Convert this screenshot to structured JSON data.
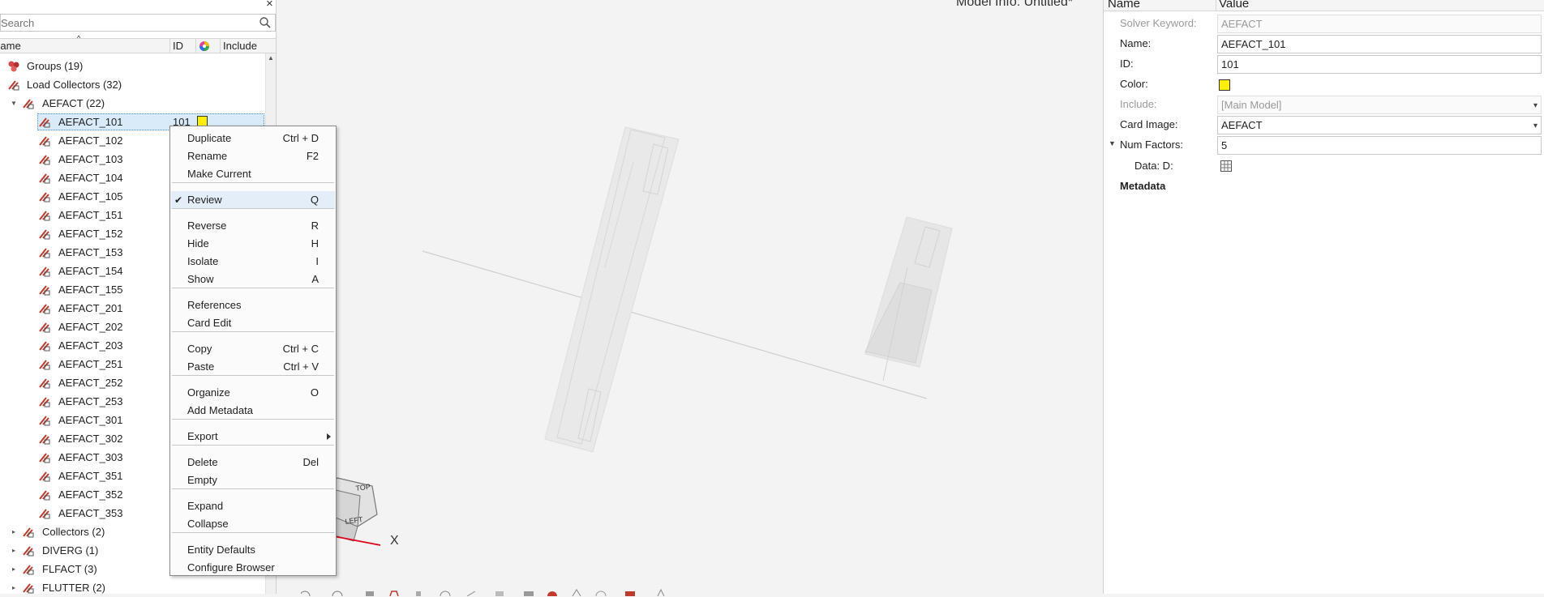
{
  "browser": {
    "search_placeholder": "Search",
    "columns": {
      "name": "Name",
      "id": "ID",
      "include": "Include"
    },
    "tree": [
      {
        "label": "Groups  (19)",
        "icon": "groups-icon"
      },
      {
        "label": "Load Collectors  (32)",
        "icon": "load-collector-icon"
      },
      {
        "label": "AEFACT  (22)",
        "icon": "load-collector-icon",
        "expanded": true
      },
      {
        "label": "AEFACT_101",
        "id": "101",
        "selected": true
      },
      {
        "label": "AEFACT_102"
      },
      {
        "label": "AEFACT_103"
      },
      {
        "label": "AEFACT_104"
      },
      {
        "label": "AEFACT_105"
      },
      {
        "label": "AEFACT_151"
      },
      {
        "label": "AEFACT_152"
      },
      {
        "label": "AEFACT_153"
      },
      {
        "label": "AEFACT_154"
      },
      {
        "label": "AEFACT_155"
      },
      {
        "label": "AEFACT_201"
      },
      {
        "label": "AEFACT_202"
      },
      {
        "label": "AEFACT_203"
      },
      {
        "label": "AEFACT_251"
      },
      {
        "label": "AEFACT_252"
      },
      {
        "label": "AEFACT_253"
      },
      {
        "label": "AEFACT_301"
      },
      {
        "label": "AEFACT_302"
      },
      {
        "label": "AEFACT_303"
      },
      {
        "label": "AEFACT_351"
      },
      {
        "label": "AEFACT_352"
      },
      {
        "label": "AEFACT_353"
      },
      {
        "label": "Collectors  (2)"
      },
      {
        "label": "DIVERG  (1)"
      },
      {
        "label": "FLFACT  (3)"
      },
      {
        "label": "FLUTTER  (2)"
      }
    ]
  },
  "viewport": {
    "model_info": "Model Info: Untitled*",
    "axis_x": "X",
    "cube_top": "TOP",
    "cube_left": "LEFT"
  },
  "context_menu": {
    "items": [
      {
        "label": "Duplicate",
        "shortcut": "Ctrl + D"
      },
      {
        "label": "Rename",
        "shortcut": "F2"
      },
      {
        "label": "Make Current",
        "shortcut": ""
      },
      {
        "label": "Review",
        "shortcut": "Q",
        "checked": true,
        "highlighted": true
      },
      {
        "label": "Reverse",
        "shortcut": "R"
      },
      {
        "label": "Hide",
        "shortcut": "H"
      },
      {
        "label": "Isolate",
        "shortcut": "I"
      },
      {
        "label": "Show",
        "shortcut": "A"
      },
      {
        "label": "References",
        "shortcut": ""
      },
      {
        "label": "Card Edit",
        "shortcut": ""
      },
      {
        "label": "Copy",
        "shortcut": "Ctrl + C"
      },
      {
        "label": "Paste",
        "shortcut": "Ctrl + V"
      },
      {
        "label": "Organize",
        "shortcut": "O"
      },
      {
        "label": "Add Metadata",
        "shortcut": ""
      },
      {
        "label": "Export",
        "shortcut": "",
        "submenu": true
      },
      {
        "label": "Delete",
        "shortcut": "Del"
      },
      {
        "label": "Empty",
        "shortcut": ""
      },
      {
        "label": "Expand",
        "shortcut": ""
      },
      {
        "label": "Collapse",
        "shortcut": ""
      },
      {
        "label": "Entity Defaults",
        "shortcut": ""
      },
      {
        "label": "Configure Browser",
        "shortcut": ""
      }
    ]
  },
  "properties": {
    "header": {
      "name": "Name",
      "value": "Value"
    },
    "rows": [
      {
        "label": "Solver Keyword:",
        "value": "AEFACT",
        "disabled": true
      },
      {
        "label": "Name:",
        "value": "AEFACT_101"
      },
      {
        "label": "ID:",
        "value": "101"
      },
      {
        "label": "Color:",
        "value": "",
        "swatch": "#ffef00"
      },
      {
        "label": "Include:",
        "value": "[Main Model]",
        "disabled": true,
        "dropdown": true
      },
      {
        "label": "Card Image:",
        "value": "AEFACT",
        "dropdown": true
      },
      {
        "label": "Num Factors:",
        "value": "5",
        "expandable": true
      },
      {
        "label": "Data: D:",
        "value": ""
      }
    ],
    "metadata": "Metadata"
  },
  "colors": {
    "selection": "#d9ebf9",
    "swatch": "#ffef00",
    "axis_x": "#e0001a"
  }
}
